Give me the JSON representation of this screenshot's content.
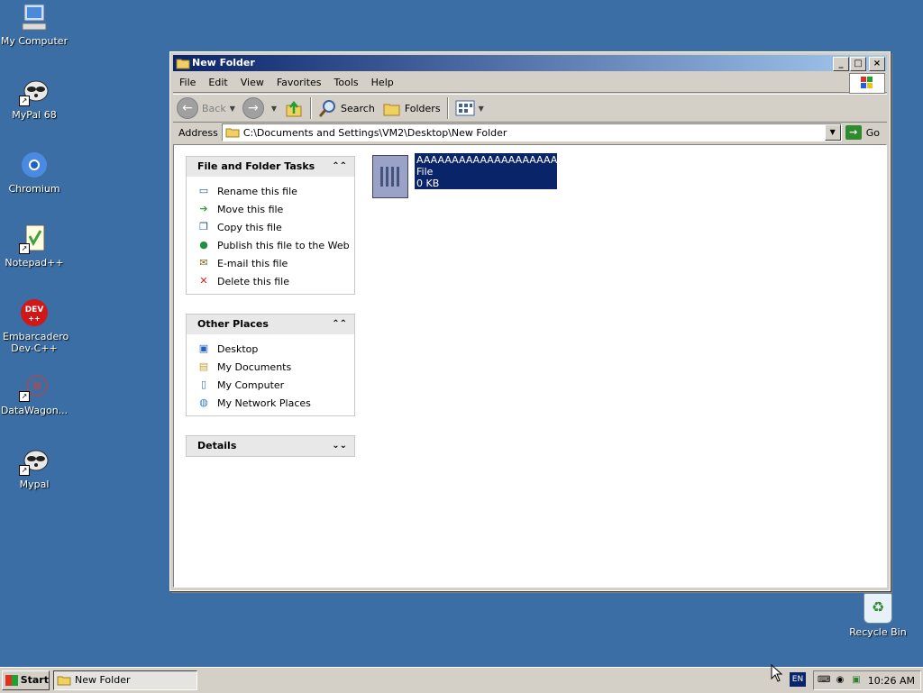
{
  "desktop": {
    "icons": [
      {
        "label": "My Computer",
        "icon": "my-computer-icon"
      },
      {
        "label": "MyPal 68",
        "icon": "mypal-raccoon-icon"
      },
      {
        "label": "Chromium",
        "icon": "chromium-icon"
      },
      {
        "label": "Notepad++",
        "icon": "notepad-plus-plus-icon"
      },
      {
        "label": "Embarcadero Dev-C++",
        "icon": "dev-cpp-icon",
        "badge": "DEV"
      },
      {
        "label": "DataWagon...",
        "icon": "datawagon-icon"
      },
      {
        "label": "Mypal",
        "icon": "mypal-raccoon-icon"
      }
    ],
    "recycle_bin": "Recycle Bin"
  },
  "window": {
    "title": "New Folder",
    "menu": [
      "File",
      "Edit",
      "View",
      "Favorites",
      "Tools",
      "Help"
    ],
    "toolbar": {
      "back": "Back",
      "search": "Search",
      "folders": "Folders"
    },
    "address": {
      "label": "Address",
      "value": "C:\\Documents and Settings\\VM2\\Desktop\\New Folder",
      "go": "Go"
    },
    "tasks": {
      "title": "File and Folder Tasks",
      "items": [
        "Rename this file",
        "Move this file",
        "Copy this file",
        "Publish this file to the Web",
        "E-mail this file",
        "Delete this file"
      ]
    },
    "other_places": {
      "title": "Other Places",
      "items": [
        "Desktop",
        "My Documents",
        "My Computer",
        "My Network Places"
      ]
    },
    "details": {
      "title": "Details"
    },
    "file": {
      "name": "AAAAAAAAAAAAAAAAAAAAAA...",
      "type": "File",
      "size": "0 KB"
    }
  },
  "taskbar": {
    "start": "Start",
    "task": "New Folder",
    "lang": "EN",
    "clock": "10:26 AM"
  },
  "colors": {
    "desktop": "#3a6ea5",
    "titlebar": "#0a246a",
    "selection": "#0a246a"
  }
}
